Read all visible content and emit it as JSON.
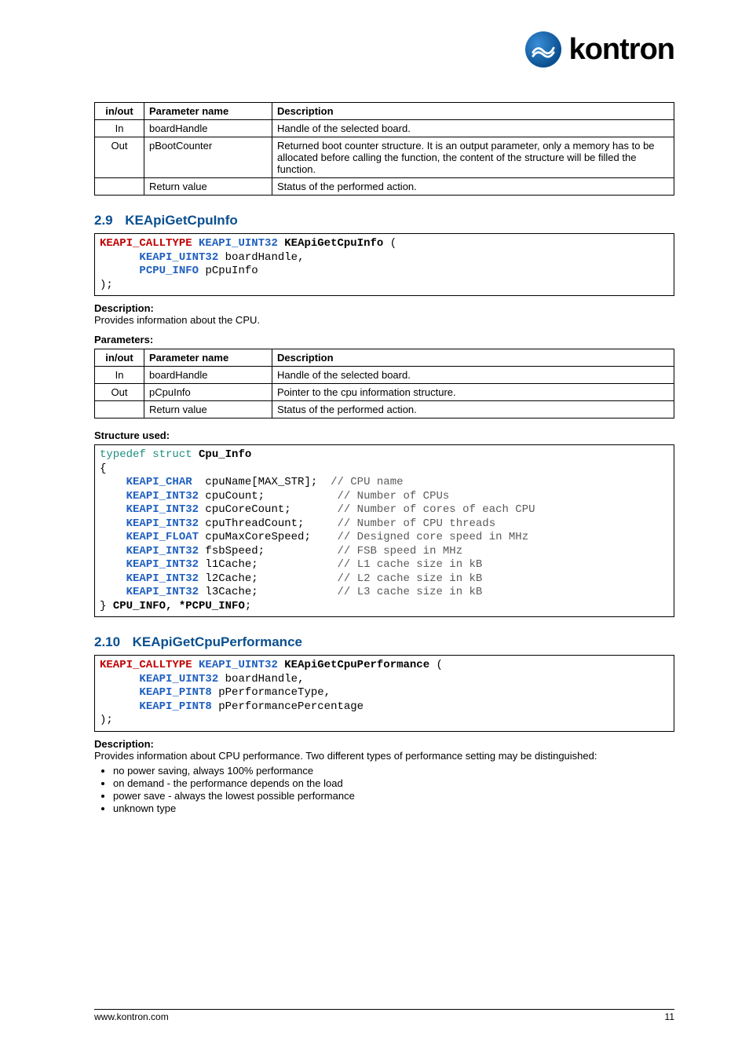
{
  "logo": {
    "word": "kontron"
  },
  "table1": {
    "headers": [
      "in/out",
      "Parameter name",
      "Description"
    ],
    "rows": [
      {
        "io": "In",
        "name": "boardHandle",
        "desc": "Handle of the selected board."
      },
      {
        "io": "Out",
        "name": "pBootCounter",
        "desc": "Returned boot counter structure. It is an output parameter, only a memory has to be allocated before calling the function, the content of the structure will be filled the function."
      },
      {
        "io": "",
        "name": "Return value",
        "desc": "Status of the performed action."
      }
    ]
  },
  "section_29": {
    "num": "2.9",
    "title": "KEApiGetCpuInfo",
    "code": {
      "sig_open": "KEAPI_CALLTYPE KEAPI_UINT32 KEApiGetCpuInfo (",
      "line1_type": "KEAPI_UINT32",
      "line1_var": " boardHandle,",
      "line2_type": "PCPU_INFO",
      "line2_var": " pCpuInfo",
      "close": ");"
    },
    "desc_label": "Description:",
    "desc_text": "Provides information about the CPU.",
    "params_label": "Parameters:"
  },
  "table2": {
    "headers": [
      "in/out",
      "Parameter name",
      "Description"
    ],
    "rows": [
      {
        "io": "In",
        "name": "boardHandle",
        "desc": "Handle of the selected board."
      },
      {
        "io": "Out",
        "name": "pCpuInfo",
        "desc": "Pointer to the cpu information structure."
      },
      {
        "io": "",
        "name": "Return value",
        "desc": "Status of the performed action."
      }
    ]
  },
  "struct_label": "Structure used:",
  "struct_code": {
    "l0a": "typedef struct ",
    "l0b": "Cpu_Info",
    "l1": "{",
    "rows": [
      {
        "t": "KEAPI_CHAR",
        "v": "  cpuName[MAX_STR];",
        "c": "// CPU name"
      },
      {
        "t": "KEAPI_INT32",
        "v": " cpuCount;",
        "c": "// Number of CPUs"
      },
      {
        "t": "KEAPI_INT32",
        "v": " cpuCoreCount;",
        "c": "// Number of cores of each CPU"
      },
      {
        "t": "KEAPI_INT32",
        "v": " cpuThreadCount;",
        "c": "// Number of CPU threads"
      },
      {
        "t": "KEAPI_FLOAT",
        "v": " cpuMaxCoreSpeed;",
        "c": "// Designed core speed in MHz"
      },
      {
        "t": "KEAPI_INT32",
        "v": " fsbSpeed;",
        "c": "// FSB speed in MHz"
      },
      {
        "t": "KEAPI_INT32",
        "v": " l1Cache;",
        "c": "// L1 cache size in kB"
      },
      {
        "t": "KEAPI_INT32",
        "v": " l2Cache;",
        "c": "// L2 cache size in kB"
      },
      {
        "t": "KEAPI_INT32",
        "v": " l3Cache;",
        "c": "// L3 cache size in kB"
      }
    ],
    "lend": "} ",
    "lend_b": "CPU_INFO, *PCPU_INFO",
    "lend_c": ";"
  },
  "section_210": {
    "num": "2.10",
    "title": "KEApiGetCpuPerformance",
    "code": {
      "sig_open": "KEAPI_CALLTYPE KEAPI_UINT32 KEApiGetCpuPerformance (",
      "l1t": "KEAPI_UINT32",
      "l1v": " boardHandle,",
      "l2t": "KEAPI_PINT8",
      "l2v": " pPerformanceType,",
      "l3t": "KEAPI_PINT8",
      "l3v": " pPerformancePercentage",
      "close": ");"
    },
    "desc_label": "Description:",
    "desc_body": "Provides information about CPU performance. Two different types of performance setting may be distinguished:",
    "bullets": [
      "no power saving, always 100% performance",
      "on demand - the performance depends on the load",
      "power save - always the lowest possible performance",
      "unknown type"
    ]
  },
  "footer": {
    "left": "www.kontron.com",
    "right": "11"
  }
}
